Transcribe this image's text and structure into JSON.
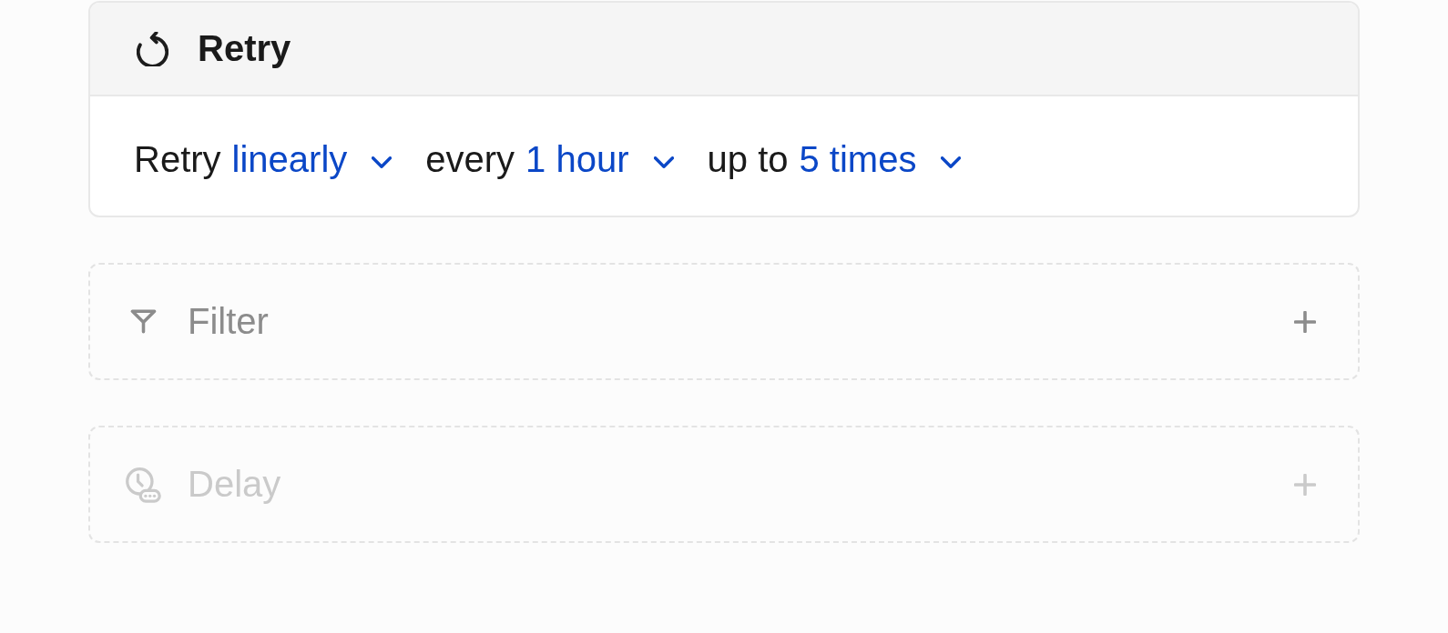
{
  "card": {
    "title": "Retry",
    "rule": [
      {
        "prefix": "Retry",
        "value": "linearly"
      },
      {
        "prefix": "every",
        "value": "1 hour"
      },
      {
        "prefix": "up to",
        "value": "5 times"
      }
    ]
  },
  "steps": [
    {
      "kind": "filter",
      "label": "Filter",
      "disabled": false
    },
    {
      "kind": "delay",
      "label": "Delay",
      "disabled": true
    }
  ]
}
